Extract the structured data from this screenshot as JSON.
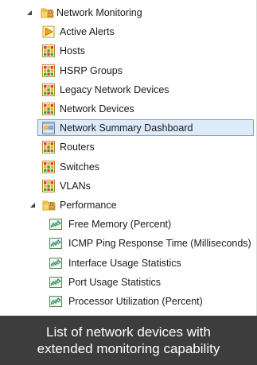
{
  "tree": {
    "root": {
      "label": "Network Monitoring",
      "icon": "folder-lock-icon",
      "expanded": true
    },
    "items": [
      {
        "label": "Active Alerts",
        "icon": "alert-view-icon"
      },
      {
        "label": "Hosts",
        "icon": "state-view-icon"
      },
      {
        "label": "HSRP Groups",
        "icon": "state-view-icon"
      },
      {
        "label": "Legacy Network Devices",
        "icon": "state-view-icon"
      },
      {
        "label": "Network Devices",
        "icon": "state-view-icon"
      },
      {
        "label": "Network Summary Dashboard",
        "icon": "dashboard-view-icon",
        "selected": true
      },
      {
        "label": "Routers",
        "icon": "state-view-icon"
      },
      {
        "label": "Switches",
        "icon": "state-view-icon"
      },
      {
        "label": "VLANs",
        "icon": "state-view-icon"
      }
    ],
    "performance": {
      "label": "Performance",
      "icon": "folder-lock-icon",
      "expanded": true,
      "items": [
        {
          "label": "Free Memory (Percent)",
          "icon": "performance-view-icon"
        },
        {
          "label": "ICMP Ping Response Time (Milliseconds)",
          "icon": "performance-view-icon"
        },
        {
          "label": "Interface Usage Statistics",
          "icon": "performance-view-icon"
        },
        {
          "label": "Port Usage Statistics",
          "icon": "performance-view-icon"
        },
        {
          "label": "Processor Utilization (Percent)",
          "icon": "performance-view-icon"
        }
      ]
    }
  },
  "caption": {
    "line1": "List of network devices with",
    "line2": "extended monitoring capability"
  },
  "colors": {
    "selection_fill": "#dceaf9",
    "selection_border": "#7da2ce",
    "caption_bg": "#3d3d3d",
    "caption_text": "#ffffff"
  }
}
